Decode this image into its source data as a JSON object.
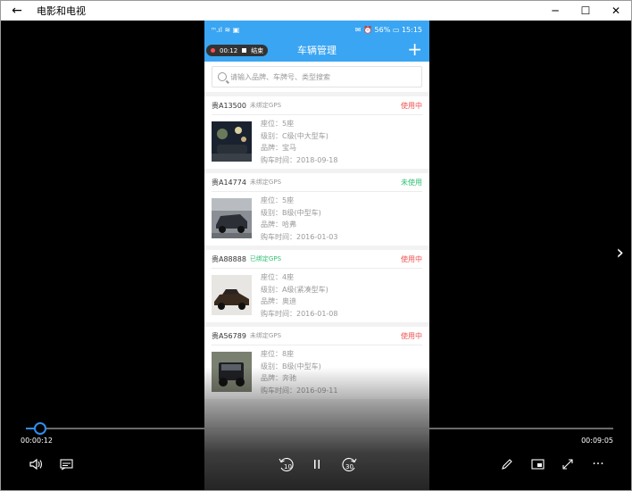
{
  "window": {
    "title": "电影和电视"
  },
  "phone": {
    "statusbar": {
      "left": "ᵐ.ıl ≋ ▣",
      "right": "✉ ⏰ 56% ▭ 15:15"
    },
    "recording": {
      "time": "00:12",
      "end_label": "结束"
    },
    "app_title": "车辆管理",
    "search_placeholder": "请输入品牌、车牌号、类型搜索",
    "vehicles": [
      {
        "plate": "贵A13500",
        "gps": "未绑定GPS",
        "status": "使用中",
        "seats": "座位：5座",
        "class": "级别：C级(中大型车)",
        "brand": "品牌：宝马",
        "date": "购车时间：2018-09-18"
      },
      {
        "plate": "贵A14774",
        "gps": "未绑定GPS",
        "status": "未使用",
        "seats": "座位：5座",
        "class": "级别：B级(中型车)",
        "brand": "品牌：哈弗",
        "date": "购车时间：2016-01-03"
      },
      {
        "plate": "贵A88888",
        "gps": "已绑定GPS",
        "status": "使用中",
        "seats": "座位：4座",
        "class": "级别：A级(紧凑型车)",
        "brand": "品牌：奥迪",
        "date": "购车时间：2016-01-08"
      },
      {
        "plate": "贵A56789",
        "gps": "未绑定GPS",
        "status": "使用中",
        "seats": "座位：8座",
        "class": "级别：B级(中型车)",
        "brand": "品牌：奔驰",
        "date": "购车时间：2016-09-11"
      }
    ]
  },
  "player": {
    "elapsed": "00:00:12",
    "total": "00:09:05",
    "progress": 0.022,
    "skip_back": "10",
    "skip_forward": "30"
  },
  "colors": {
    "accent": "#2f8ef0",
    "appbar": "#3aa5f2",
    "busy": "#f05050",
    "free": "#2fbf71"
  }
}
